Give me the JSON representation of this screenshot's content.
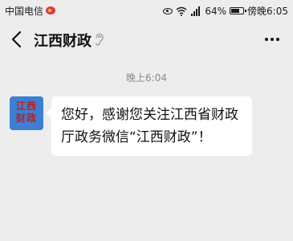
{
  "status_bar": {
    "carrier": "中国电信",
    "battery": "64%",
    "clock": "傍晚6:05",
    "icons": [
      "weibo-icon",
      "eye-icon",
      "wifi-icon",
      "signal-icon",
      "battery-icon"
    ]
  },
  "header": {
    "title": "江西财政",
    "icons": [
      "back-arrow-icon",
      "ear-icon",
      "more-icon"
    ]
  },
  "chat": {
    "timestamp": "晚上6:04",
    "avatar_text": "江西财政",
    "message": "您好，感谢您关注江西省财政厅政务微信“江西财政”！"
  },
  "colors": {
    "background": "#ededed",
    "bubble": "#ffffff",
    "avatar_bg": "#3d7fd1",
    "avatar_text": "#c41c1c"
  }
}
